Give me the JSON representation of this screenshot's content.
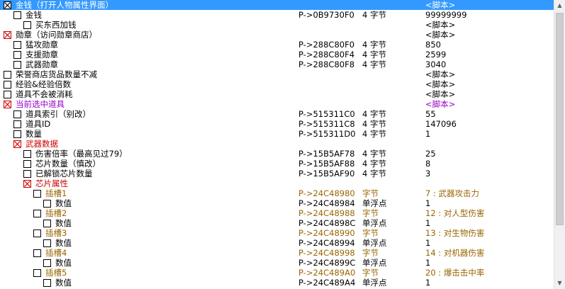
{
  "rows": [
    {
      "indent": 0,
      "checked": true,
      "red": false,
      "selected": true,
      "color": "",
      "desc": "金钱（打开人物属性界面）",
      "addr": "",
      "type": "",
      "val": "<脚本>"
    },
    {
      "indent": 1,
      "checked": false,
      "red": false,
      "selected": false,
      "color": "",
      "desc": "金钱",
      "addr": "P->0B9730F0",
      "type": "4 字节",
      "val": "99999999"
    },
    {
      "indent": 2,
      "checked": false,
      "red": false,
      "selected": false,
      "color": "",
      "desc": "买东西加钱",
      "addr": "",
      "type": "",
      "val": "<脚本>"
    },
    {
      "indent": 0,
      "checked": true,
      "red": true,
      "selected": false,
      "color": "",
      "desc": "勋章（访问勋章商店）",
      "addr": "",
      "type": "",
      "val": "<脚本>"
    },
    {
      "indent": 1,
      "checked": false,
      "red": false,
      "selected": false,
      "color": "",
      "desc": "猛攻勋章",
      "addr": "P->288C80F0",
      "type": "4 字节",
      "val": "850"
    },
    {
      "indent": 1,
      "checked": false,
      "red": false,
      "selected": false,
      "color": "",
      "desc": "支援勋章",
      "addr": "P->288C80F4",
      "type": "4 字节",
      "val": "2599"
    },
    {
      "indent": 1,
      "checked": false,
      "red": false,
      "selected": false,
      "color": "",
      "desc": "武器勋章",
      "addr": "P->288C80F8",
      "type": "4 字节",
      "val": "3040"
    },
    {
      "indent": 0,
      "checked": false,
      "red": false,
      "selected": false,
      "color": "",
      "desc": "荣誉商店货品数量不减",
      "addr": "",
      "type": "",
      "val": "<脚本>"
    },
    {
      "indent": 0,
      "checked": false,
      "red": false,
      "selected": false,
      "color": "",
      "desc": "经验&经验倍数",
      "addr": "",
      "type": "",
      "val": "<脚本>"
    },
    {
      "indent": 0,
      "checked": false,
      "red": false,
      "selected": false,
      "color": "",
      "desc": "道具不会被消耗",
      "addr": "",
      "type": "",
      "val": "<脚本>"
    },
    {
      "indent": 0,
      "checked": true,
      "red": true,
      "selected": false,
      "color": "purple",
      "desc": "当前选中道具",
      "addr": "",
      "type": "",
      "val": "<脚本>"
    },
    {
      "indent": 1,
      "checked": false,
      "red": false,
      "selected": false,
      "color": "",
      "desc": "道具索引（别改）",
      "addr": "P->515311C0",
      "type": "4 字节",
      "val": "55"
    },
    {
      "indent": 1,
      "checked": false,
      "red": false,
      "selected": false,
      "color": "",
      "desc": "道具ID",
      "addr": "P->515311C8",
      "type": "4 字节",
      "val": "147096"
    },
    {
      "indent": 1,
      "checked": false,
      "red": false,
      "selected": false,
      "color": "",
      "desc": "数量",
      "addr": "P->515311D0",
      "type": "4 字节",
      "val": "1"
    },
    {
      "indent": 1,
      "checked": true,
      "red": true,
      "selected": false,
      "color": "red",
      "desc": "武器数据",
      "addr": "",
      "type": "",
      "val": ""
    },
    {
      "indent": 2,
      "checked": false,
      "red": false,
      "selected": false,
      "color": "",
      "desc": "伤害倍率（最高见过79）",
      "addr": "P->15B5AF78",
      "type": "4 字节",
      "val": "25"
    },
    {
      "indent": 2,
      "checked": false,
      "red": false,
      "selected": false,
      "color": "",
      "desc": "芯片数量（慎改）",
      "addr": "P->15B5AF88",
      "type": "4 字节",
      "val": "8"
    },
    {
      "indent": 2,
      "checked": false,
      "red": false,
      "selected": false,
      "color": "",
      "desc": "已解锁芯片数量",
      "addr": "P->15B5AF90",
      "type": "4 字节",
      "val": "3"
    },
    {
      "indent": 2,
      "checked": true,
      "red": true,
      "selected": false,
      "color": "red",
      "desc": "芯片属性",
      "addr": "",
      "type": "",
      "val": ""
    },
    {
      "indent": 3,
      "checked": false,
      "red": false,
      "selected": false,
      "color": "brown",
      "desc": "插槽1",
      "addr": "P->24C48980",
      "type": "字节",
      "val": "7 : 武器攻击力"
    },
    {
      "indent": 4,
      "checked": false,
      "red": false,
      "selected": false,
      "color": "",
      "desc": "数值",
      "addr": "P->24C48984",
      "type": "单浮点",
      "val": "1"
    },
    {
      "indent": 3,
      "checked": false,
      "red": false,
      "selected": false,
      "color": "brown",
      "desc": "插槽2",
      "addr": "P->24C48988",
      "type": "字节",
      "val": "12 : 对人型伤害"
    },
    {
      "indent": 4,
      "checked": false,
      "red": false,
      "selected": false,
      "color": "",
      "desc": "数值",
      "addr": "P->24C4898C",
      "type": "单浮点",
      "val": "1"
    },
    {
      "indent": 3,
      "checked": false,
      "red": false,
      "selected": false,
      "color": "brown",
      "desc": "插槽3",
      "addr": "P->24C48990",
      "type": "字节",
      "val": "13 : 对生物伤害"
    },
    {
      "indent": 4,
      "checked": false,
      "red": false,
      "selected": false,
      "color": "",
      "desc": "数值",
      "addr": "P->24C48994",
      "type": "单浮点",
      "val": "1"
    },
    {
      "indent": 3,
      "checked": false,
      "red": false,
      "selected": false,
      "color": "brown",
      "desc": "插槽4",
      "addr": "P->24C48998",
      "type": "字节",
      "val": "14 : 对机器伤害"
    },
    {
      "indent": 4,
      "checked": false,
      "red": false,
      "selected": false,
      "color": "",
      "desc": "数值",
      "addr": "P->24C4899C",
      "type": "单浮点",
      "val": "1"
    },
    {
      "indent": 3,
      "checked": false,
      "red": false,
      "selected": false,
      "color": "brown",
      "desc": "插槽5",
      "addr": "P->24C489A0",
      "type": "字节",
      "val": "20 : 爆击击中率"
    },
    {
      "indent": 4,
      "checked": false,
      "red": false,
      "selected": false,
      "color": "",
      "desc": "数值",
      "addr": "P->24C489A4",
      "type": "单浮点",
      "val": "1"
    }
  ],
  "scrollbar": {
    "up_icon": "arrow-up-icon",
    "down_icon": "arrow-down-icon"
  }
}
